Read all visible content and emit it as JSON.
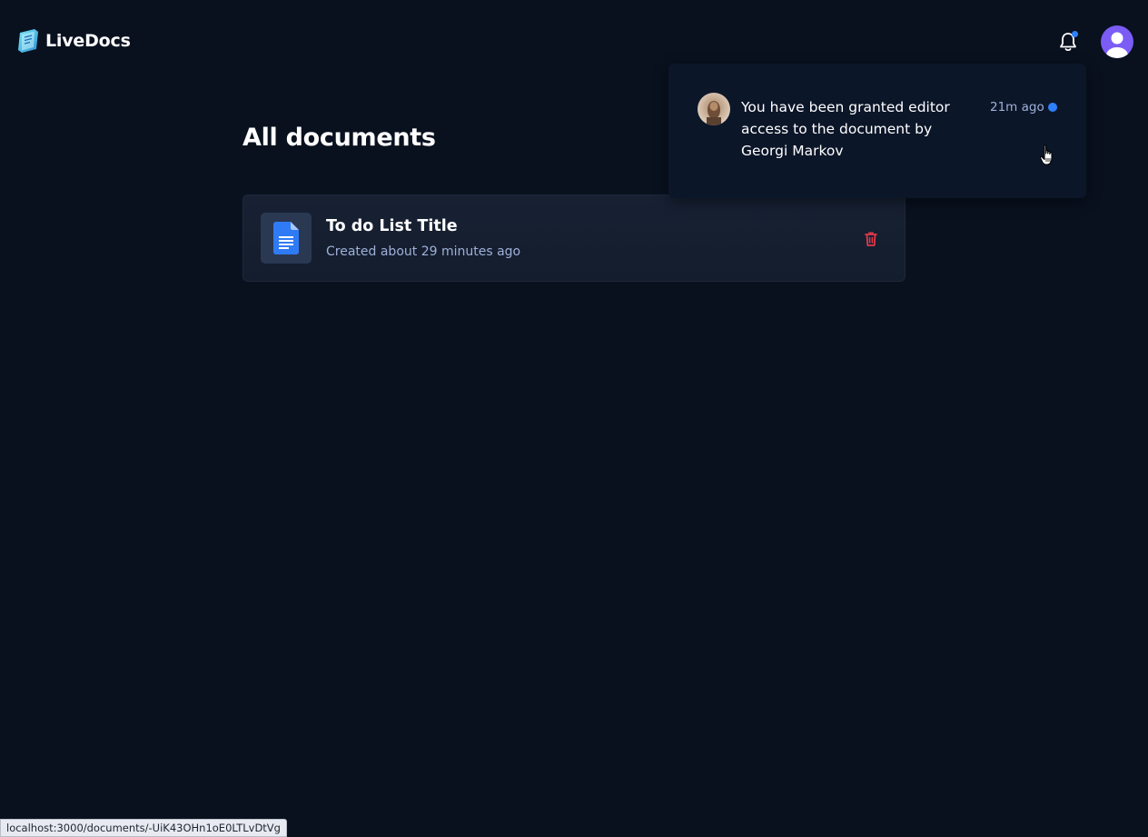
{
  "header": {
    "brand_name": "LiveDocs",
    "notification_badge": true
  },
  "main": {
    "page_title": "All documents",
    "documents": [
      {
        "title": "To do List Title",
        "created": "Created about 29 minutes ago"
      }
    ]
  },
  "notifications": [
    {
      "message": "You have been granted editor access to the document by Georgi Markov",
      "time": "21m ago",
      "unread": true
    }
  ],
  "status_bar": {
    "url": "localhost:3000/documents/-UiK43OHn1oE0LTLvDtVg"
  },
  "icons": {
    "brand": "livedocs-logo-icon",
    "bell": "bell-icon",
    "avatar": "user-avatar-icon",
    "document": "document-file-icon",
    "delete": "trash-icon",
    "cursor": "hand-pointer-icon"
  },
  "colors": {
    "background": "#09111f",
    "card": "#172133",
    "panel": "#0c1629",
    "accent": "#2f80ff",
    "avatar": "#7b5cf5",
    "danger": "#e0394a",
    "muted_text": "#9eb0d8"
  }
}
